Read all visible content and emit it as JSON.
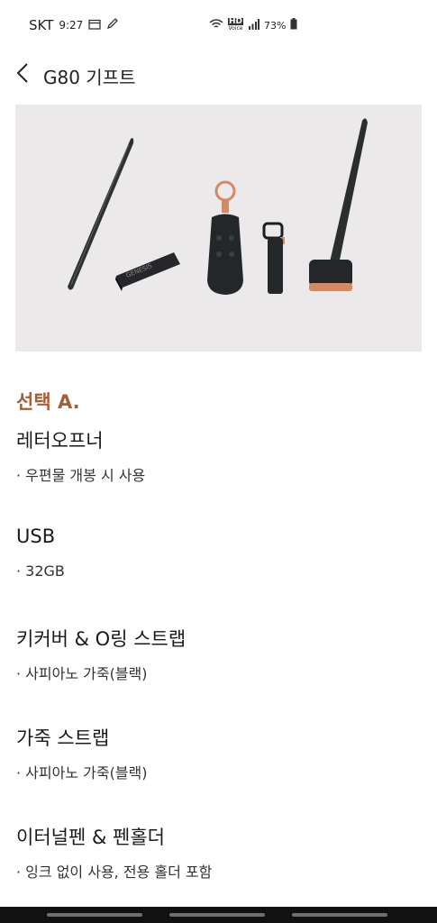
{
  "status_bar": {
    "carrier": "SKT",
    "time": "9:27",
    "network_label": "HD",
    "network_sub": "Voice",
    "battery": "73%"
  },
  "header": {
    "title": "G80 기프트"
  },
  "option": {
    "title": "선택 A.",
    "items": [
      {
        "name": "레터오프너",
        "desc": "· 우편물 개봉 시 사용"
      },
      {
        "name": "USB",
        "desc": "· 32GB"
      },
      {
        "name": "키커버 & O링 스트랩",
        "desc": "· 사피아노 가죽(블랙)"
      },
      {
        "name": "가죽 스트랩",
        "desc": "· 사피아노 가죽(블랙)"
      },
      {
        "name": "이터널펜 & 펜홀더",
        "desc": "· 잉크 없이 사용, 전용 홀더 포함"
      }
    ]
  },
  "hero": {
    "usb_brand": "GENESIS"
  },
  "colors": {
    "accent": "#a0603a",
    "hero_bg": "#ebe9ea",
    "product_dark": "#2a2d2b",
    "copper": "#d28a64"
  }
}
